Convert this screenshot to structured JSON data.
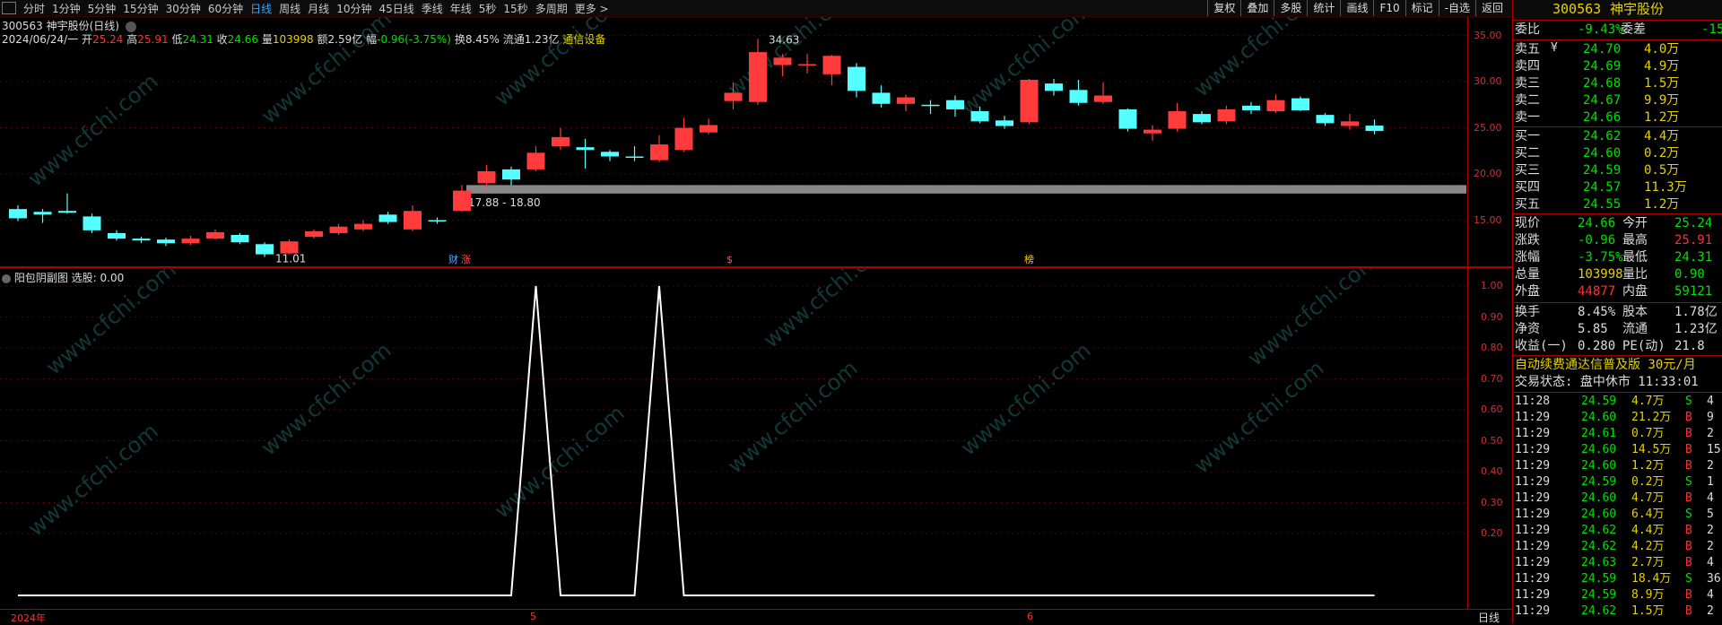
{
  "toolbar": {
    "tabs": [
      "分时",
      "1分钟",
      "5分钟",
      "15分钟",
      "30分钟",
      "60分钟",
      "日线",
      "周线",
      "月线",
      "10分钟",
      "45日线",
      "季线",
      "年线",
      "5秒",
      "15秒",
      "多周期",
      "更多 >"
    ],
    "active_tab": "日线",
    "tools": [
      "复权",
      "叠加",
      "多股",
      "统计",
      "画线",
      "F10",
      "标记",
      "-自选",
      "返回"
    ]
  },
  "main": {
    "stock_line": "300563 神宇股份(日线)",
    "date": "2024/06/24/一",
    "open_label": "开",
    "open": "25.24",
    "high_label": "高",
    "high": "25.91",
    "low_label": "低",
    "low": "24.31",
    "close_label": "收",
    "close": "24.66",
    "vol_label": "量",
    "vol": "103998",
    "amount_label": "额",
    "amount": "2.59亿",
    "change_label": "幅",
    "change": "-0.96(-3.75%)",
    "turnover_label": "换",
    "turnover": "8.45%",
    "float_label": "流通",
    "float": "1.23亿",
    "sector": "通信设备",
    "max_label": "34.63",
    "min_label": "11.01",
    "gap_label": "17.88 - 18.80",
    "event_marks": [
      "财",
      "涨",
      "$",
      "榜"
    ],
    "y_ticks": [
      "35.00",
      "30.00",
      "25.00",
      "20.00",
      "15.00"
    ]
  },
  "sub": {
    "title": "阳包阴副图",
    "value_label": "选股: 0.00",
    "y_ticks": [
      "1.00",
      "0.90",
      "0.80",
      "0.70",
      "0.60",
      "0.50",
      "0.40",
      "0.30",
      "0.20"
    ],
    "x_labels": [
      "2024年",
      "5",
      "6"
    ],
    "period_label": "日线"
  },
  "candles": [
    {
      "o": 16.2,
      "c": 15.2,
      "h": 16.6,
      "l": 14.9
    },
    {
      "o": 15.9,
      "c": 15.6,
      "h": 16.2,
      "l": 14.7
    },
    {
      "o": 16.0,
      "c": 15.8,
      "h": 17.9,
      "l": 15.7
    },
    {
      "o": 15.4,
      "c": 13.9,
      "h": 15.7,
      "l": 13.6
    },
    {
      "o": 13.6,
      "c": 13.0,
      "h": 13.9,
      "l": 12.8
    },
    {
      "o": 13.0,
      "c": 12.8,
      "h": 13.2,
      "l": 12.5
    },
    {
      "o": 12.9,
      "c": 12.5,
      "h": 13.1,
      "l": 12.2
    },
    {
      "o": 12.5,
      "c": 13.0,
      "h": 13.3,
      "l": 12.3
    },
    {
      "o": 13.0,
      "c": 13.7,
      "h": 14.0,
      "l": 12.9
    },
    {
      "o": 13.4,
      "c": 12.6,
      "h": 13.6,
      "l": 12.4
    },
    {
      "o": 12.4,
      "c": 11.3,
      "h": 12.6,
      "l": 11.01
    },
    {
      "o": 11.4,
      "c": 12.7,
      "h": 12.9,
      "l": 11.3
    },
    {
      "o": 13.2,
      "c": 13.8,
      "h": 14.0,
      "l": 13.0
    },
    {
      "o": 13.6,
      "c": 14.3,
      "h": 14.6,
      "l": 13.4
    },
    {
      "o": 14.0,
      "c": 14.6,
      "h": 15.0,
      "l": 13.8
    },
    {
      "o": 15.6,
      "c": 14.8,
      "h": 15.9,
      "l": 14.6
    },
    {
      "o": 14.0,
      "c": 16.0,
      "h": 16.6,
      "l": 13.8
    },
    {
      "o": 15.0,
      "c": 14.9,
      "h": 15.3,
      "l": 14.6
    },
    {
      "o": 16.0,
      "c": 18.2,
      "h": 18.8,
      "l": 15.9
    },
    {
      "o": 19.0,
      "c": 20.3,
      "h": 21.0,
      "l": 18.6
    },
    {
      "o": 20.5,
      "c": 19.4,
      "h": 20.8,
      "l": 18.8
    },
    {
      "o": 20.5,
      "c": 22.3,
      "h": 23.0,
      "l": 20.3
    },
    {
      "o": 23.0,
      "c": 24.0,
      "h": 25.0,
      "l": 22.6
    },
    {
      "o": 22.9,
      "c": 22.6,
      "h": 23.8,
      "l": 20.6
    },
    {
      "o": 22.4,
      "c": 21.9,
      "h": 22.6,
      "l": 21.4
    },
    {
      "o": 21.9,
      "c": 21.8,
      "h": 23.0,
      "l": 21.4
    },
    {
      "o": 21.5,
      "c": 23.2,
      "h": 24.2,
      "l": 21.3
    },
    {
      "o": 22.6,
      "c": 25.0,
      "h": 26.1,
      "l": 22.4
    },
    {
      "o": 24.5,
      "c": 25.3,
      "h": 26.0,
      "l": 24.3
    },
    {
      "o": 27.9,
      "c": 28.8,
      "h": 29.9,
      "l": 27.0
    },
    {
      "o": 27.8,
      "c": 33.2,
      "h": 34.63,
      "l": 27.5
    },
    {
      "o": 31.8,
      "c": 32.6,
      "h": 33.0,
      "l": 30.6
    },
    {
      "o": 31.8,
      "c": 31.9,
      "h": 33.0,
      "l": 30.9
    },
    {
      "o": 30.8,
      "c": 32.8,
      "h": 32.9,
      "l": 29.6
    },
    {
      "o": 31.6,
      "c": 29.0,
      "h": 32.0,
      "l": 28.3
    },
    {
      "o": 28.8,
      "c": 27.6,
      "h": 29.6,
      "l": 27.2
    },
    {
      "o": 27.6,
      "c": 28.3,
      "h": 28.6,
      "l": 26.8
    },
    {
      "o": 27.5,
      "c": 27.4,
      "h": 28.0,
      "l": 26.5
    },
    {
      "o": 28.0,
      "c": 27.0,
      "h": 28.5,
      "l": 26.2
    },
    {
      "o": 26.8,
      "c": 25.7,
      "h": 27.3,
      "l": 25.5
    },
    {
      "o": 25.8,
      "c": 25.2,
      "h": 26.3,
      "l": 24.9
    },
    {
      "o": 25.6,
      "c": 30.2,
      "h": 30.3,
      "l": 25.4
    },
    {
      "o": 29.8,
      "c": 29.0,
      "h": 30.3,
      "l": 28.5
    },
    {
      "o": 29.1,
      "c": 27.7,
      "h": 30.2,
      "l": 27.4
    },
    {
      "o": 27.8,
      "c": 28.5,
      "h": 29.9,
      "l": 27.6
    },
    {
      "o": 27.0,
      "c": 24.9,
      "h": 27.1,
      "l": 24.6
    },
    {
      "o": 24.4,
      "c": 24.8,
      "h": 25.3,
      "l": 23.6
    },
    {
      "o": 24.9,
      "c": 26.8,
      "h": 27.7,
      "l": 24.6
    },
    {
      "o": 26.5,
      "c": 25.6,
      "h": 26.8,
      "l": 25.4
    },
    {
      "o": 25.7,
      "c": 27.0,
      "h": 27.4,
      "l": 25.4
    },
    {
      "o": 27.4,
      "c": 26.9,
      "h": 27.8,
      "l": 26.5
    },
    {
      "o": 26.8,
      "c": 28.0,
      "h": 28.6,
      "l": 26.6
    },
    {
      "o": 28.2,
      "c": 26.9,
      "h": 28.4,
      "l": 26.8
    },
    {
      "o": 26.4,
      "c": 25.5,
      "h": 26.6,
      "l": 25.2
    },
    {
      "o": 25.2,
      "c": 25.7,
      "h": 26.5,
      "l": 24.8
    },
    {
      "o": 25.24,
      "c": 24.66,
      "h": 25.91,
      "l": 24.31
    }
  ],
  "signal": [
    0,
    0,
    0,
    0,
    0,
    0,
    0,
    0,
    0,
    0,
    0,
    0,
    0,
    0,
    0,
    0,
    0,
    0,
    0,
    0,
    0,
    1,
    0,
    0,
    0,
    0,
    1,
    0,
    0,
    0,
    0,
    0,
    0,
    0,
    0,
    0,
    0,
    0,
    0,
    0,
    0,
    0,
    0,
    0,
    0,
    0,
    0,
    0,
    0,
    0,
    0,
    0,
    0,
    0,
    0,
    0
  ],
  "panel": {
    "code": "300563",
    "name": "神宇股份",
    "weibi_label": "委比",
    "weibi": "-9.43%",
    "weicha_label": "委差",
    "weicha": "-15",
    "asks": [
      {
        "label": "卖五",
        "price": "24.70",
        "vol": "4.0万"
      },
      {
        "label": "卖四",
        "price": "24.69",
        "vol": "4.9万"
      },
      {
        "label": "卖三",
        "price": "24.68",
        "vol": "1.5万"
      },
      {
        "label": "卖二",
        "price": "24.67",
        "vol": "9.9万"
      },
      {
        "label": "卖一",
        "price": "24.66",
        "vol": "1.2万"
      }
    ],
    "ask_flag": "¥",
    "bids": [
      {
        "label": "买一",
        "price": "24.62",
        "vol": "4.4万"
      },
      {
        "label": "买二",
        "price": "24.60",
        "vol": "0.2万"
      },
      {
        "label": "买三",
        "price": "24.59",
        "vol": "0.5万"
      },
      {
        "label": "买四",
        "price": "24.57",
        "vol": "11.3万"
      },
      {
        "label": "买五",
        "price": "24.55",
        "vol": "1.2万"
      }
    ],
    "quote": [
      {
        "l1": "现价",
        "v1": "24.66",
        "c1": "green",
        "l2": "今开",
        "v2": "25.24",
        "c2": "green"
      },
      {
        "l1": "涨跌",
        "v1": "-0.96",
        "c1": "green",
        "l2": "最高",
        "v2": "25.91",
        "c2": "red"
      },
      {
        "l1": "涨幅",
        "v1": "-3.75%",
        "c1": "green",
        "l2": "最低",
        "v2": "24.31",
        "c2": "green"
      },
      {
        "l1": "总量",
        "v1": "103998",
        "c1": "yellow",
        "l2": "量比",
        "v2": "0.90",
        "c2": "green"
      },
      {
        "l1": "外盘",
        "v1": "44877",
        "c1": "red",
        "l2": "内盘",
        "v2": "59121",
        "c2": "green"
      }
    ],
    "fund": [
      {
        "l1": "换手",
        "v1": "8.45%",
        "l2": "股本",
        "v2": "1.78亿"
      },
      {
        "l1": "净资",
        "v1": "5.85",
        "l2": "流通",
        "v2": "1.23亿"
      },
      {
        "l1": "收益(一)",
        "v1": "0.280",
        "l2": "PE(动)",
        "v2": "21.8"
      }
    ],
    "promo": "自动续费通达信普及版 30元/月",
    "status": "交易状态: 盘中休市 11:33:01",
    "ticks": [
      {
        "t": "11:28",
        "p": "24.59",
        "v": "4.7万",
        "s": "S",
        "n": "4"
      },
      {
        "t": "11:29",
        "p": "24.60",
        "v": "21.2万",
        "s": "B",
        "n": "9"
      },
      {
        "t": "11:29",
        "p": "24.61",
        "v": "0.7万",
        "s": "B",
        "n": "2"
      },
      {
        "t": "11:29",
        "p": "24.60",
        "v": "14.5万",
        "s": "B",
        "n": "15"
      },
      {
        "t": "11:29",
        "p": "24.60",
        "v": "1.2万",
        "s": "B",
        "n": "2"
      },
      {
        "t": "11:29",
        "p": "24.59",
        "v": "0.2万",
        "s": "S",
        "n": "1"
      },
      {
        "t": "11:29",
        "p": "24.60",
        "v": "4.7万",
        "s": "B",
        "n": "4"
      },
      {
        "t": "11:29",
        "p": "24.60",
        "v": "6.4万",
        "s": "S",
        "n": "5"
      },
      {
        "t": "11:29",
        "p": "24.62",
        "v": "4.4万",
        "s": "B",
        "n": "2"
      },
      {
        "t": "11:29",
        "p": "24.62",
        "v": "4.2万",
        "s": "B",
        "n": "2"
      },
      {
        "t": "11:29",
        "p": "24.63",
        "v": "2.7万",
        "s": "B",
        "n": "4"
      },
      {
        "t": "11:29",
        "p": "24.59",
        "v": "18.4万",
        "s": "S",
        "n": "36"
      },
      {
        "t": "11:29",
        "p": "24.59",
        "v": "8.9万",
        "s": "B",
        "n": "4"
      },
      {
        "t": "11:29",
        "p": "24.62",
        "v": "1.5万",
        "s": "B",
        "n": "2"
      }
    ]
  },
  "watermark": "www.cfchi.com",
  "colors": {
    "up": "#ff3b3b",
    "down": "#54ffff",
    "signal": "#ffffff",
    "grid": "#5a0000"
  }
}
